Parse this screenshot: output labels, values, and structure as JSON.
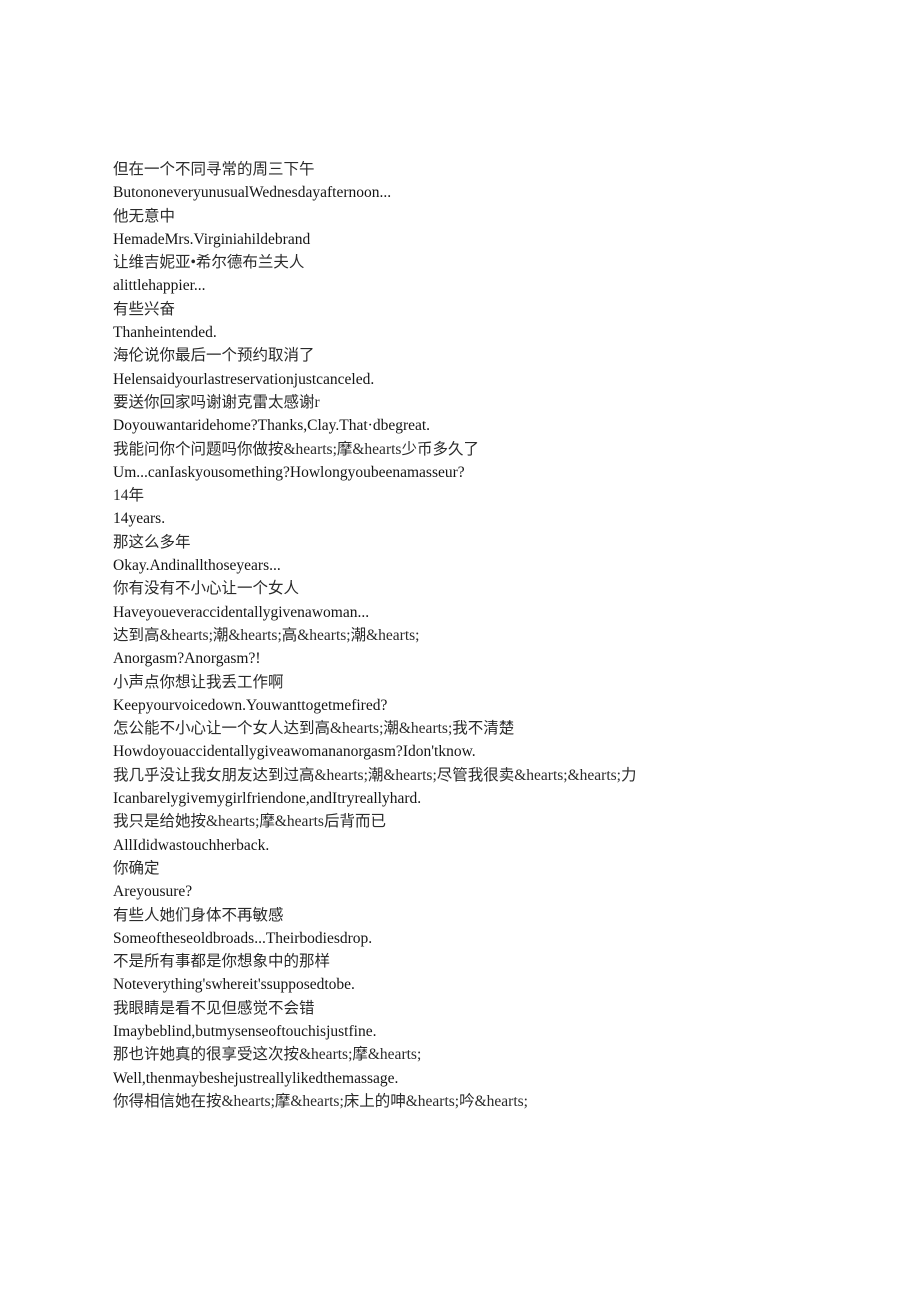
{
  "document": {
    "type": "bilingual-subtitle-transcript",
    "background_color": "#ffffff",
    "text_color_zh": "#2a2a2a",
    "text_color_en": "#141414",
    "lines": [
      {
        "lang": "zh",
        "text": "但在一个不同寻常的周三下午"
      },
      {
        "lang": "en",
        "text": "ButononeveryunusualWednesdayafternoon..."
      },
      {
        "lang": "zh",
        "text": "他无意中"
      },
      {
        "lang": "en",
        "text": "HemadeMrs.Virginiahildebrand"
      },
      {
        "lang": "zh",
        "text": "让维吉妮亚•希尔德布兰夫人"
      },
      {
        "lang": "en",
        "text": "alittlehappier..."
      },
      {
        "lang": "zh",
        "text": "有些兴奋"
      },
      {
        "lang": "en",
        "text": "Thanheintended."
      },
      {
        "lang": "zh",
        "text": "海伦说你最后一个预约取消了"
      },
      {
        "lang": "en",
        "text": "Helensaidyourlastreservationjustcanceled."
      },
      {
        "lang": "zh",
        "text": "要送你回家吗谢谢克雷太感谢r"
      },
      {
        "lang": "en",
        "text": "Doyouwantaridehome?Thanks,Clay.That·dbegreat."
      },
      {
        "lang": "zh",
        "text": "我能问你个问题吗你做按&hearts;摩&hearts少币多久了"
      },
      {
        "lang": "en",
        "text": "Um...canIaskyousomething?Howlongyoubeenamasseur?"
      },
      {
        "lang": "zh",
        "text": "14年"
      },
      {
        "lang": "en",
        "text": "14years."
      },
      {
        "lang": "zh",
        "text": "那这么多年"
      },
      {
        "lang": "en",
        "text": "Okay.Andinallthoseyears..."
      },
      {
        "lang": "zh",
        "text": "你有没有不小心让一个女人"
      },
      {
        "lang": "en",
        "text": "Haveyoueveraccidentallygivenawoman..."
      },
      {
        "lang": "zh",
        "text": "达到高&hearts;潮&hearts;高&hearts;潮&hearts;"
      },
      {
        "lang": "en",
        "text": "Anorgasm?Anorgasm?!"
      },
      {
        "lang": "zh",
        "text": "小声点你想让我丢工作啊"
      },
      {
        "lang": "en",
        "text": "Keepyourvoicedown.Youwanttogetmefired?"
      },
      {
        "lang": "zh",
        "text": "怎公能不小心让一个女人达到高&hearts;潮&hearts;我不清楚"
      },
      {
        "lang": "en",
        "text": "Howdoyouaccidentallygiveawomananorgasm?Idon'tknow."
      },
      {
        "lang": "zh",
        "text": "我几乎没让我女朋友达到过高&hearts;潮&hearts;尽管我很卖&hearts;&hearts;力"
      },
      {
        "lang": "en",
        "text": "Icanbarelygivemygirlfriendone,andItryreallyhard."
      },
      {
        "lang": "zh",
        "text": "我只是给她按&hearts;摩&hearts后背而已"
      },
      {
        "lang": "en",
        "text": "AllIdidwastouchherback."
      },
      {
        "lang": "zh",
        "text": "你确定"
      },
      {
        "lang": "en",
        "text": "Areyousure?"
      },
      {
        "lang": "zh",
        "text": "有些人她们身体不再敏感"
      },
      {
        "lang": "en",
        "text": "Someoftheseoldbroads...Theirbodiesdrop."
      },
      {
        "lang": "zh",
        "text": "不是所有事都是你想象中的那样"
      },
      {
        "lang": "en",
        "text": "Noteverything'swhereit'ssupposedtobe."
      },
      {
        "lang": "zh",
        "text": "我眼睛是看不见但感觉不会错"
      },
      {
        "lang": "en",
        "text": "Imaybeblind,butmysenseoftouchisjustfine."
      },
      {
        "lang": "zh",
        "text": "那也许她真的很享受这次按&hearts;摩&hearts;"
      },
      {
        "lang": "en",
        "text": "Well,thenmaybeshejustreallylikedthemassage."
      },
      {
        "lang": "zh",
        "text": "你得相信她在按&hearts;摩&hearts;床上的呻&hearts;吟&hearts;"
      }
    ]
  }
}
